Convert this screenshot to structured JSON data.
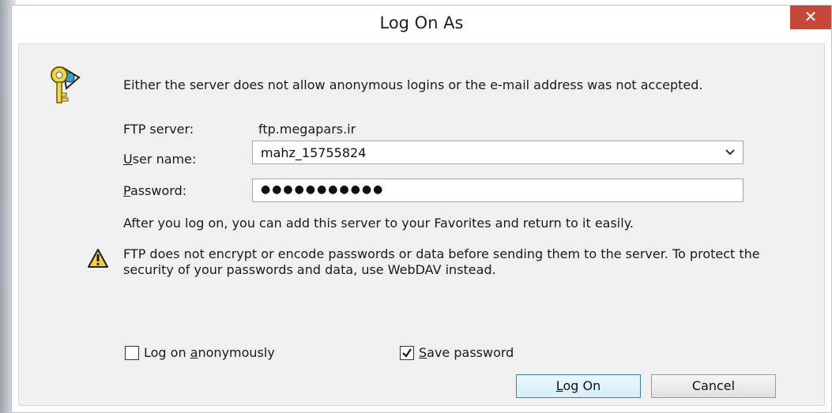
{
  "window": {
    "title": "Log On As",
    "close_glyph": "✕"
  },
  "intro": {
    "icon": "key-globe-icon",
    "text": "Either the server does not allow anonymous logins or the e-mail address was not accepted."
  },
  "ftp_server": {
    "label": "FTP server:",
    "value": "ftp.megapars.ir"
  },
  "user_name": {
    "label": "User name:",
    "accesskey": "U",
    "value": "mahz_15755824"
  },
  "password": {
    "label": "Password:",
    "accesskey": "P",
    "value": "●●●●●●●●●●●"
  },
  "favorites_note": "After you log on, you can add this server to your Favorites and return to it easily.",
  "warning": {
    "icon": "warning-icon",
    "text": "FTP does not encrypt or encode passwords or data before sending them to the server.  To protect the security of your passwords and data, use WebDAV instead."
  },
  "options": {
    "anonymous": {
      "label": "Log on anonymously",
      "checked": false
    },
    "save_password": {
      "label": "Save password",
      "checked": true
    }
  },
  "buttons": {
    "logon": "Log On",
    "cancel": "Cancel"
  },
  "colors": {
    "close": "#c7463a",
    "default_button_border": "#3c7fb1"
  }
}
